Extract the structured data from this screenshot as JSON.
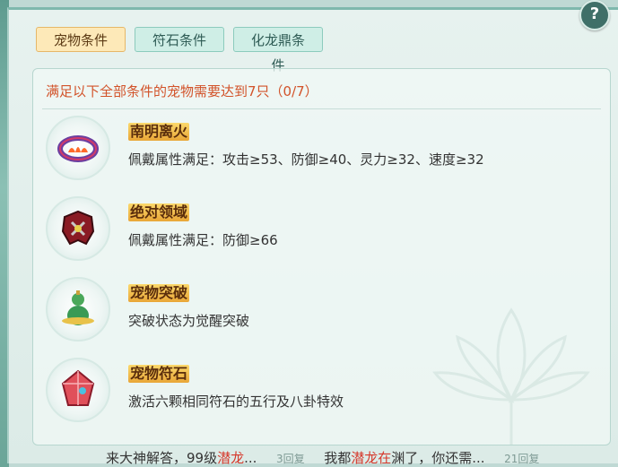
{
  "tabs": [
    {
      "label": "宠物条件",
      "active": true
    },
    {
      "label": "符石条件",
      "active": false
    },
    {
      "label": "化龙鼎条件",
      "active": false
    }
  ],
  "help_icon": "?",
  "requirement_title": "满足以下全部条件的宠物需要达到7只（0/7）",
  "items": [
    {
      "name": "南明离火",
      "desc": "佩戴属性满足：攻击≥53、防御≥40、灵力≥32、速度≥32",
      "icon": "ring-icon"
    },
    {
      "name": "绝对领域",
      "desc": "佩戴属性满足：防御≥66",
      "icon": "armor-icon"
    },
    {
      "name": "宠物突破",
      "desc": "突破状态为觉醒突破",
      "icon": "gourd-icon"
    },
    {
      "name": "宠物符石",
      "desc": "激活六颗相同符石的五行及八卦特效",
      "icon": "runestone-icon"
    }
  ],
  "chat": {
    "part1": "来大神解答，99级",
    "part1_red": "潜龙",
    "part1_end": "...",
    "reply1": "3回复",
    "part2": "我都",
    "part2_red": "潜龙在",
    "part2_end": "渊了，你还需...",
    "reply2": "21回复"
  },
  "colors": {
    "accent_orange": "#d2532a",
    "tab_active_bg": "#fde9b8",
    "tab_inactive_bg": "#cfeee6",
    "name_gold": "#e9a637"
  }
}
